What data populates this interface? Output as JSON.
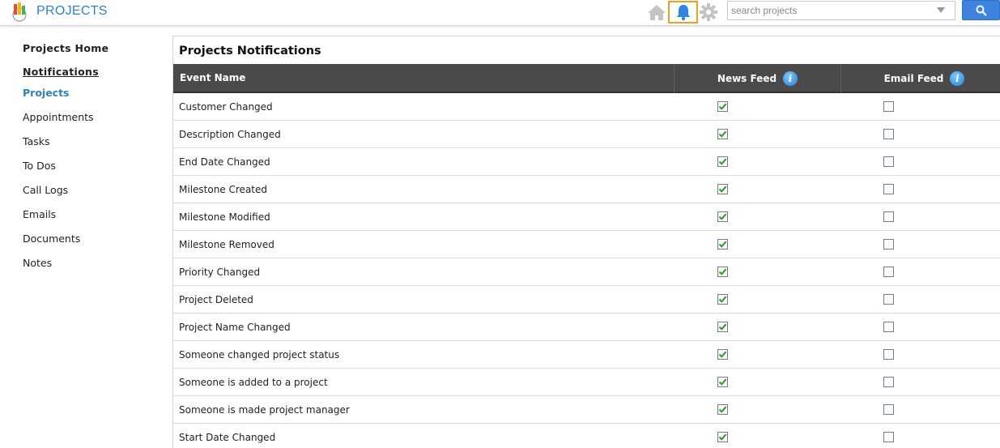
{
  "header": {
    "app_title": "PROJECTS",
    "search_placeholder": "search projects",
    "icons": [
      "app-logo-icon",
      "home-icon",
      "bell-icon",
      "gear-icon",
      "search-icon"
    ]
  },
  "sidebar": {
    "items": [
      {
        "label": "Projects Home"
      },
      {
        "label": "Notifications"
      },
      {
        "label": "Projects"
      },
      {
        "label": "Appointments"
      },
      {
        "label": "Tasks"
      },
      {
        "label": "To Dos"
      },
      {
        "label": "Call Logs"
      },
      {
        "label": "Emails"
      },
      {
        "label": "Documents"
      },
      {
        "label": "Notes"
      }
    ]
  },
  "main": {
    "title": "Projects Notifications",
    "columns": {
      "event": "Event Name",
      "news": "News Feed",
      "email": "Email Feed"
    },
    "rows": [
      {
        "event": "Customer Changed",
        "news": true,
        "email": false
      },
      {
        "event": "Description Changed",
        "news": true,
        "email": false
      },
      {
        "event": "End Date Changed",
        "news": true,
        "email": false
      },
      {
        "event": "Milestone Created",
        "news": true,
        "email": false
      },
      {
        "event": "Milestone Modified",
        "news": true,
        "email": false
      },
      {
        "event": "Milestone Removed",
        "news": true,
        "email": false
      },
      {
        "event": "Priority Changed",
        "news": true,
        "email": false
      },
      {
        "event": "Project Deleted",
        "news": true,
        "email": false
      },
      {
        "event": "Project Name Changed",
        "news": true,
        "email": false
      },
      {
        "event": "Someone changed project status",
        "news": true,
        "email": false
      },
      {
        "event": "Someone is added to a project",
        "news": true,
        "email": false
      },
      {
        "event": "Someone is made project manager",
        "news": true,
        "email": false
      },
      {
        "event": "Start Date Changed",
        "news": true,
        "email": false
      }
    ]
  },
  "colors": {
    "brand": "#2d82c8",
    "highlight": "#f0a020",
    "table_header": "#4a4a4a",
    "check": "#2a9a2a",
    "search_button": "#3f83e0"
  }
}
